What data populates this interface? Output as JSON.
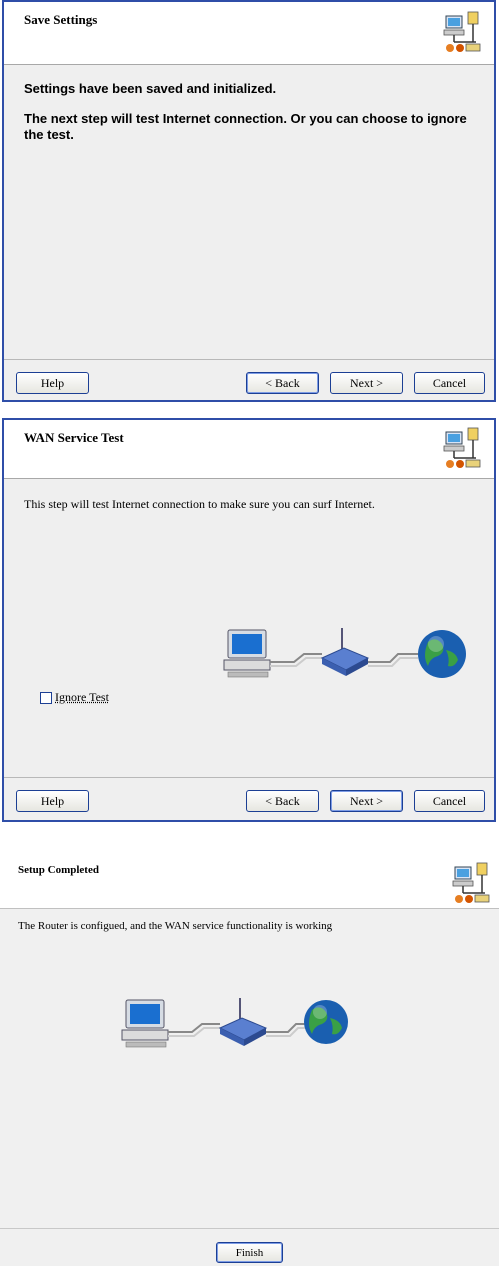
{
  "panel1": {
    "title": "Save Settings",
    "line1": "Settings have been saved and initialized.",
    "line2": "The next step will test Internet connection. Or you can choose to ignore",
    "line3": "the test.",
    "buttons": {
      "help": "Help",
      "back": "< Back",
      "next": "Next >",
      "cancel": "Cancel"
    }
  },
  "panel2": {
    "title": "WAN Service Test",
    "description": "This step will test Internet connection to make sure you can surf Internet.",
    "ignore_label": "Ignore Test",
    "buttons": {
      "help": "Help",
      "back": "< Back",
      "next": "Next >",
      "cancel": "Cancel"
    }
  },
  "panel3": {
    "title": "Setup Completed",
    "description": "The Router is configued, and the WAN service functionality is working",
    "buttons": {
      "finish": "Finish"
    }
  },
  "icons": [
    "network-wizard-icon",
    "computer-icon",
    "router-icon",
    "globe-icon"
  ]
}
